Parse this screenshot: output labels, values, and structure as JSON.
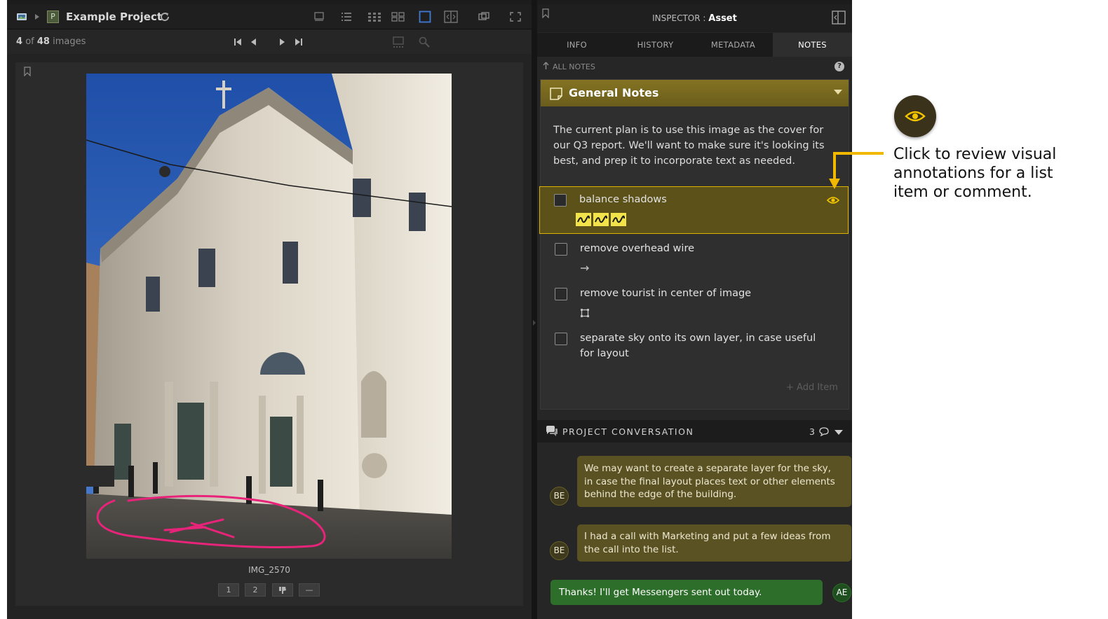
{
  "project": {
    "title": "Example Project",
    "letter": "P"
  },
  "viewer": {
    "current": "4",
    "of": "of",
    "total": "48",
    "unit": "images",
    "filename": "IMG_2570",
    "ratings": [
      "1",
      "2",
      "",
      "—"
    ]
  },
  "inspector": {
    "title_prefix": "INSPECTOR : ",
    "title_bold": "Asset",
    "tabs": [
      {
        "label": "INFO",
        "active": false
      },
      {
        "label": "HISTORY",
        "active": false
      },
      {
        "label": "METADATA",
        "active": false
      },
      {
        "label": "NOTES",
        "active": true
      }
    ],
    "breadcrumb": "ALL NOTES",
    "help": "?"
  },
  "notes": {
    "title": "General Notes",
    "body": "The current plan is to use this image as the cover for our Q3 report. We'll want to make sure it's looking its best, and prep it to incorporate text as needed.",
    "items": [
      {
        "text": "balance shadows",
        "annotation": "scribble-icons",
        "selected": true
      },
      {
        "text": "remove overhead wire",
        "annotation": "arrow-icon",
        "selected": false
      },
      {
        "text": "remove tourist in center of image",
        "annotation": "rectangle-icon",
        "selected": false
      },
      {
        "text": "separate sky onto its own layer, in case useful for layout",
        "annotation": "",
        "selected": false
      }
    ],
    "add_item": "+ Add Item"
  },
  "conversation": {
    "title": "PROJECT CONVERSATION",
    "count": "3",
    "messages": [
      {
        "author": "BE",
        "text_lines": [
          "We may want to create a separate layer for the sky,",
          "in case the final layout places text or other elements",
          "behind the edge of the building."
        ]
      },
      {
        "author": "BE",
        "text_lines": [
          "I had a call with Marketing and put a few ideas from",
          "the call into the list."
        ]
      },
      {
        "author": "AE",
        "text_lines": [
          "Thanks! I'll get Messengers sent out today."
        ]
      }
    ]
  },
  "callout": {
    "lines": [
      "Click to review visual",
      "annotations for a list",
      "item or comment."
    ]
  },
  "colors": {
    "accent_gold": "#d9b300",
    "notes_header": "#847322",
    "selected_item": "#5c5219",
    "bubble_other": "#5a5223",
    "bubble_self": "#2d6e2a",
    "annotation_pink": "#e8237a"
  }
}
